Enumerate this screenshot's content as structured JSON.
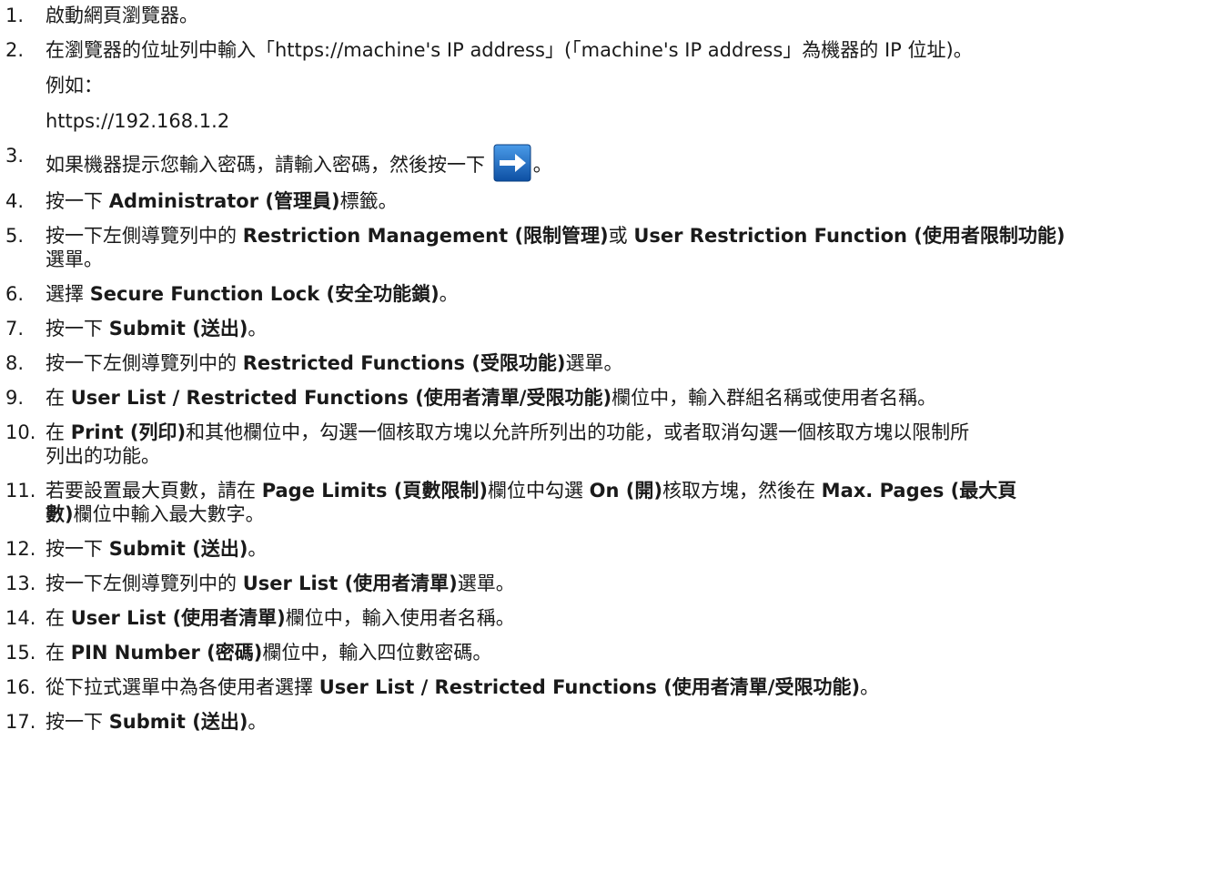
{
  "steps": [
    {
      "num": "1.",
      "t1": "啟動網頁瀏覽器。"
    },
    {
      "num": "2.",
      "t1": "在瀏覽器的位址列中輸入「https://machine's IP address」(「machine's IP address」為機器的 IP 位址)。",
      "example_label": "例如：",
      "example_url": "https://192.168.1.2"
    },
    {
      "num": "3.",
      "t1": "如果機器提示您輸入密碼，請輸入密碼，然後按一下",
      "t2": "。",
      "icon": "arrow-right-icon"
    },
    {
      "num": "4.",
      "t1": "按一下 ",
      "b1": "Administrator (管理員)",
      "t2": "標籤。"
    },
    {
      "num": "5.",
      "t1": "按一下左側導覽列中的 ",
      "b1": "Restriction Management (限制管理)",
      "t2": "或 ",
      "b2": "User Restriction Function (使用者限制功能)",
      "t3": "選單。"
    },
    {
      "num": "6.",
      "t1": "選擇 ",
      "b1": "Secure Function Lock (安全功能鎖)",
      "t2": "。"
    },
    {
      "num": "7.",
      "t1": "按一下 ",
      "b1": "Submit (送出)",
      "t2": "。"
    },
    {
      "num": "8.",
      "t1": "按一下左側導覽列中的 ",
      "b1": "Restricted Functions (受限功能)",
      "t2": "選單。"
    },
    {
      "num": "9.",
      "t1": "在 ",
      "b1": "User List / Restricted Functions (使用者清單/受限功能)",
      "t2": "欄位中，輸入群組名稱或使用者名稱。"
    },
    {
      "num": "10.",
      "t1": "在 ",
      "b1": "Print (列印)",
      "t2": "和其他欄位中，勾選一個核取方塊以允許所列出的功能，或者取消勾選一個核取方塊以限制所",
      "t3": "列出的功能。"
    },
    {
      "num": "11.",
      "t1": "若要設置最大頁數，請在 ",
      "b1": "Page Limits (頁數限制)",
      "t2": "欄位中勾選 ",
      "b2": "On (開)",
      "t3": "核取方塊，然後在 ",
      "b3": "Max. Pages (最大頁",
      "b4": "數)",
      "t4": "欄位中輸入最大數字。"
    },
    {
      "num": "12.",
      "t1": "按一下 ",
      "b1": "Submit (送出)",
      "t2": "。"
    },
    {
      "num": "13.",
      "t1": "按一下左側導覽列中的 ",
      "b1": "User List (使用者清單)",
      "t2": "選單。"
    },
    {
      "num": "14.",
      "t1": "在 ",
      "b1": "User List (使用者清單)",
      "t2": "欄位中，輸入使用者名稱。"
    },
    {
      "num": "15.",
      "t1": "在 ",
      "b1": "PIN Number (密碼)",
      "t2": "欄位中，輸入四位數密碼。"
    },
    {
      "num": "16.",
      "t1": "從下拉式選單中為各使用者選擇 ",
      "b1": "User List / Restricted Functions (使用者清單/受限功能)",
      "t2": "。"
    },
    {
      "num": "17.",
      "t1": "按一下 ",
      "b1": "Submit (送出)",
      "t2": "。"
    }
  ],
  "colors": {
    "text": "#1a1a1a",
    "button_blue": "#1565c0",
    "button_light": "#3d8fe0"
  }
}
